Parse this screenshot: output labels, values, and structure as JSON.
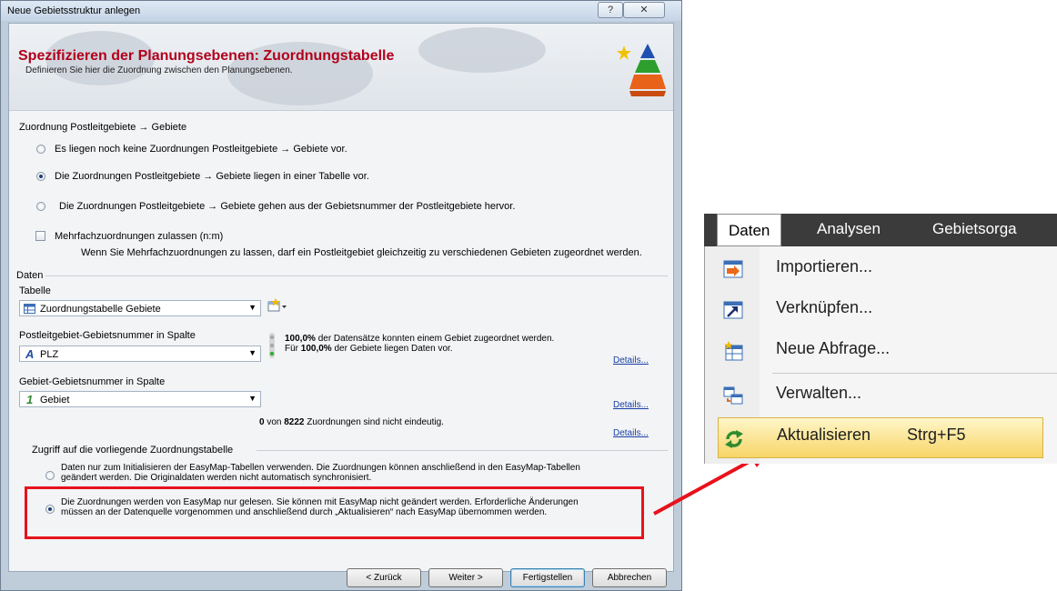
{
  "dialog": {
    "title": "Neue Gebietsstruktur anlegen",
    "help_glyph": "?",
    "close_glyph": "✕",
    "heading": "Spezifizieren der Planungsebenen: Zuordnungstabelle",
    "subheading": "Definieren Sie hier die Zuordnung zwischen den Planungsebenen.",
    "zuordnung": {
      "label": "Zuordnung Postleitgebiete → Gebiete",
      "options": [
        "Es liegen noch keine Zuordnungen Postleitgebiete → Gebiete vor.",
        "Die Zuordnungen Postleitgebiete → Gebiete liegen in einer Tabelle vor.",
        "Die Zuordnungen Postleitgebiete → Gebiete gehen aus der Gebietsnummer der Postleitgebiete hervor."
      ],
      "selected_index": 1
    },
    "mehrfach": {
      "checkbox_label": "Mehrfachzuordnungen zulassen (n:m)",
      "checked": false,
      "description": "Wenn Sie Mehrfachzuordnungen zu lassen, darf ein Postleitgebiet gleichzeitig zu verschiedenen Gebieten zugeordnet werden."
    },
    "daten": {
      "group_label": "Daten",
      "tabelle_label": "Tabelle",
      "tabelle_value": "Zuordnungstabelle Gebiete",
      "plz_label": "Postleitgebiet-Gebietsnummer in Spalte",
      "plz_icon_glyph": "A",
      "plz_value": "PLZ",
      "stat1_bold": "100,0%",
      "stat1_text": " der Datensätze konnten einem Gebiet zugeordnet werden.",
      "stat2_prefix": "Für ",
      "stat2_bold": "100,0%",
      "stat2_text": " der Gebiete liegen Daten vor.",
      "gebiet_label": "Gebiet-Gebietsnummer in Spalte",
      "gebiet_icon_glyph": "1",
      "gebiet_value": "Gebiet",
      "eindeutig_bold1": "0",
      "eindeutig_text1": " von ",
      "eindeutig_bold2": "8222",
      "eindeutig_text2": " Zuordnungen sind nicht eindeutig.",
      "details_label": "Details..."
    },
    "zugriff": {
      "group_label": "Zugriff auf die vorliegende Zuordnungstabelle",
      "option1_line1": "Daten nur zum Initialisieren der EasyMap-Tabellen verwenden. Die Zuordnungen können anschließend in den EasyMap-Tabellen",
      "option1_line2": "geändert werden. Die Originaldaten werden nicht automatisch synchronisiert.",
      "option2_line1": "Die Zuordnungen werden von EasyMap nur gelesen. Sie können mit EasyMap nicht geändert werden. Erforderliche Änderungen",
      "option2_line2": "müssen an der Datenquelle vorgenommen und anschließend durch „Aktualisieren“ nach EasyMap übernommen werden.",
      "selected_index": 1
    },
    "buttons": {
      "back": "< Zurück",
      "next": "Weiter >",
      "finish": "Fertigstellen",
      "cancel": "Abbrechen"
    }
  },
  "menu": {
    "bar": [
      "Daten",
      "Analysen",
      "Gebietsorga"
    ],
    "items": [
      {
        "label": "Importieren...",
        "shortcut": ""
      },
      {
        "label": "Verknüpfen...",
        "shortcut": ""
      },
      {
        "label": "Neue Abfrage...",
        "shortcut": ""
      },
      {
        "label": "Verwalten...",
        "shortcut": ""
      },
      {
        "label": "Aktualisieren",
        "shortcut": "Strg+F5"
      }
    ],
    "highlighted_index": 4
  },
  "colors": {
    "heading_red": "#b2001c",
    "callout_red": "#e8121c",
    "menu_bar_dark": "#3b3b3b",
    "menu_highlight": "#f7d567"
  }
}
